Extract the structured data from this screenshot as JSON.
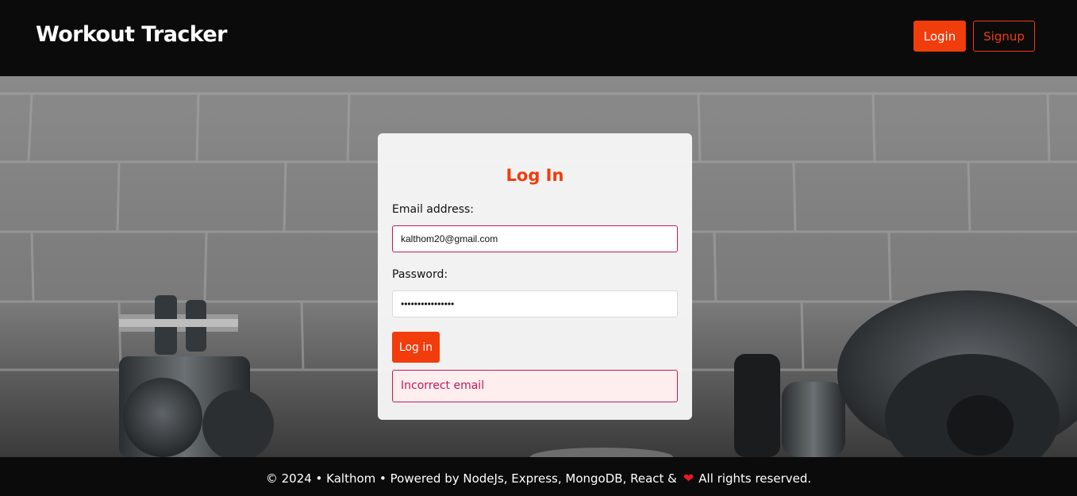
{
  "header": {
    "brand": "Workout Tracker",
    "login_label": "Login",
    "signup_label": "Signup"
  },
  "login_form": {
    "title": "Log In",
    "email_label": "Email address:",
    "email_value": "kalthom20@gmail.com",
    "password_label": "Password:",
    "password_value": "••••••••••••••••",
    "submit_label": "Log in",
    "error_message": "Incorrect email"
  },
  "footer": {
    "text_before": "© 2024 • Kalthom • Powered by NodeJs, Express, MongoDB, React &",
    "heart_icon": "heart-icon",
    "text_after": "All rights reserved."
  },
  "colors": {
    "accent": "#f13c0c",
    "error": "#c2185b",
    "header_bg": "#0b0b0b"
  }
}
